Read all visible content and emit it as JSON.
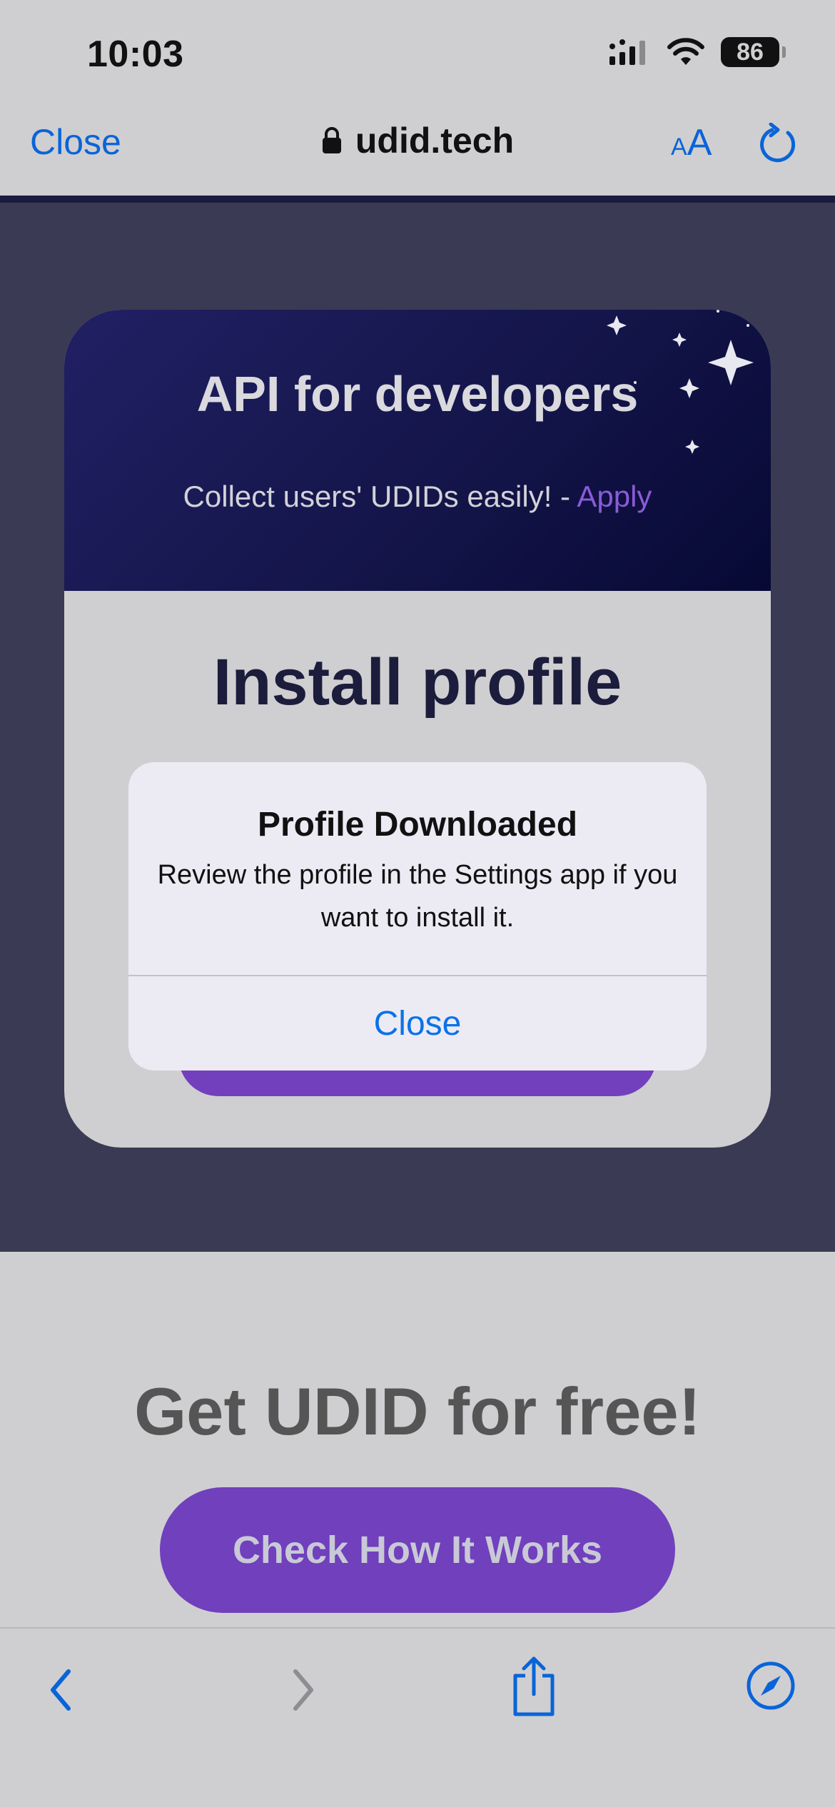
{
  "status_bar": {
    "time": "10:03",
    "battery": "86"
  },
  "top_bar": {
    "close_label": "Close",
    "url": "udid.tech",
    "text_size_label_small": "A",
    "text_size_label_large": "A"
  },
  "hero": {
    "title": "API for developers",
    "subtitle": "Collect users' UDIDs easily! - ",
    "apply_link": "Apply"
  },
  "install": {
    "title": "Install profile"
  },
  "alert": {
    "title": "Profile Downloaded",
    "message": "Review the profile in the Settings app if you want to install it.",
    "close_label": "Close"
  },
  "promo": {
    "title": "Get UDID for free!",
    "button": "Check How It Works"
  },
  "colors": {
    "accent_blue": "#0a64d8",
    "purple": "#7040bd",
    "dark_band": "#3a3a54"
  },
  "toolbar": {
    "icons": [
      "back-icon",
      "forward-icon",
      "share-icon",
      "compass-icon"
    ]
  }
}
